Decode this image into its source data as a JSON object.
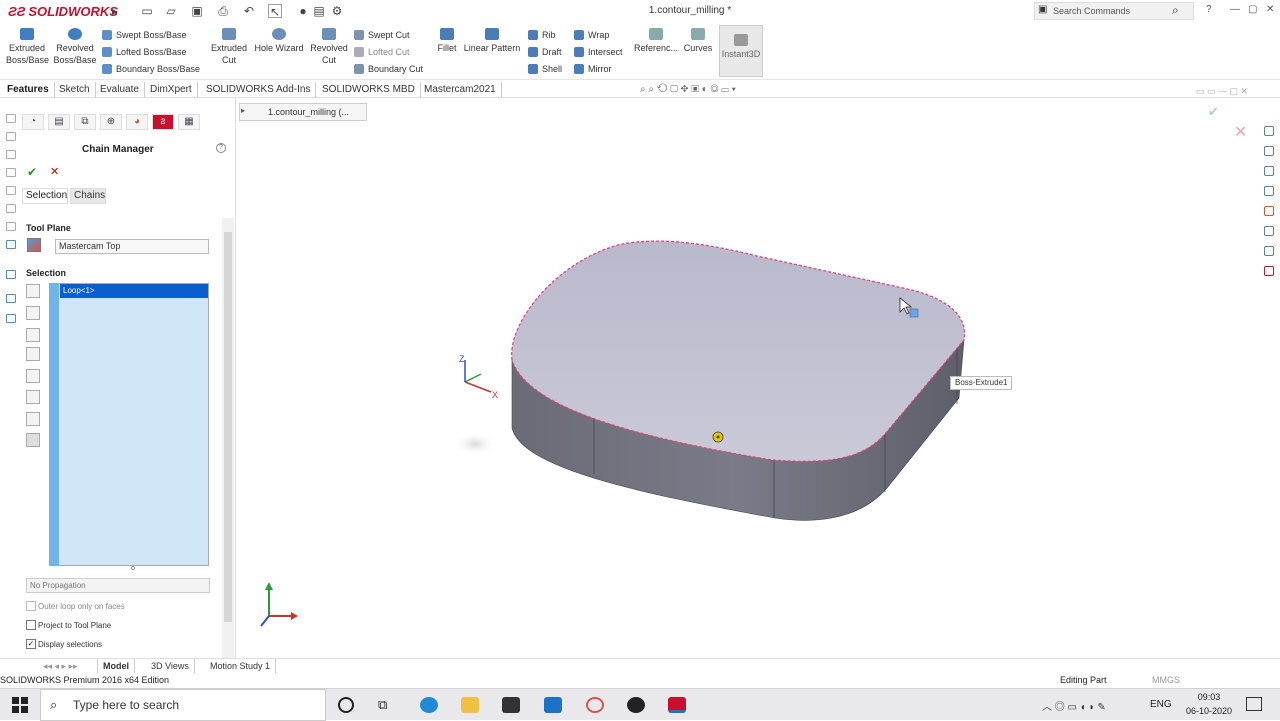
{
  "titlebar": {
    "logo": "SOLIDWORKS",
    "document_title": "1.contour_milling *",
    "search_placeholder": "Search Commands"
  },
  "ribbon": {
    "extruded_boss": "Extruded\nBoss/Base",
    "revolved_boss": "Revolved\nBoss/Base",
    "swept_boss": "Swept Boss/Base",
    "lofted_boss": "Lofted Boss/Base",
    "boundary_boss": "Boundary Boss/Base",
    "extruded_cut": "Extruded\nCut",
    "hole_wizard": "Hole Wizard",
    "revolved_cut": "Revolved\nCut",
    "swept_cut": "Swept Cut",
    "lofted_cut": "Lofted Cut",
    "boundary_cut": "Boundary Cut",
    "fillet": "Fillet",
    "linear_pattern": "Linear Pattern",
    "rib": "Rib",
    "draft": "Draft",
    "shell": "Shell",
    "wrap": "Wrap",
    "intersect": "Intersect",
    "mirror": "Mirror",
    "reference": "Referenc...",
    "curves": "Curves",
    "instant3d": "Instant3D"
  },
  "tabs": [
    "Features",
    "Sketch",
    "Evaluate",
    "DimXpert",
    "SOLIDWORKS Add-Ins",
    "SOLIDWORKS MBD",
    "Mastercam2021"
  ],
  "breadcrumb": "1.contour_milling  (...",
  "panel": {
    "title": "Chain Manager",
    "help": "?",
    "ok_glyph": "✔",
    "cancel_glyph": "✕",
    "tab_selection": "Selection",
    "tab_chains": "Chains",
    "tool_plane_label": "Tool Plane",
    "tool_plane_value": "Mastercam Top",
    "selection_label": "Selection",
    "selection_item": "Loop<1>",
    "propagation": "No Propagation",
    "outer_loop": "Outer loop only on faces",
    "project_to_plane": "Project to Tool Plane",
    "display_selections": "Display selections",
    "display_selections_checked": true
  },
  "viewport": {
    "callout": "Boss-Extrude1",
    "triad_labels": {
      "z": "Z",
      "x": "X"
    }
  },
  "model_tabs": [
    "Model",
    "3D Views",
    "Motion Study 1"
  ],
  "status": {
    "edition": "SOLIDWORKS Premium 2016 x64 Edition",
    "mode": "Editing Part",
    "units": "MMGS"
  },
  "taskbar": {
    "search_placeholder": "Type here to search",
    "language": "ENG",
    "time": "09:03",
    "date": "06-10-2020"
  },
  "colors": {
    "accent_red": "#c8102e",
    "selection_blue": "#0a5fce",
    "list_bg": "#cfe6f7",
    "body_top": "#c5c5d8",
    "body_side": "#6b6c78"
  }
}
